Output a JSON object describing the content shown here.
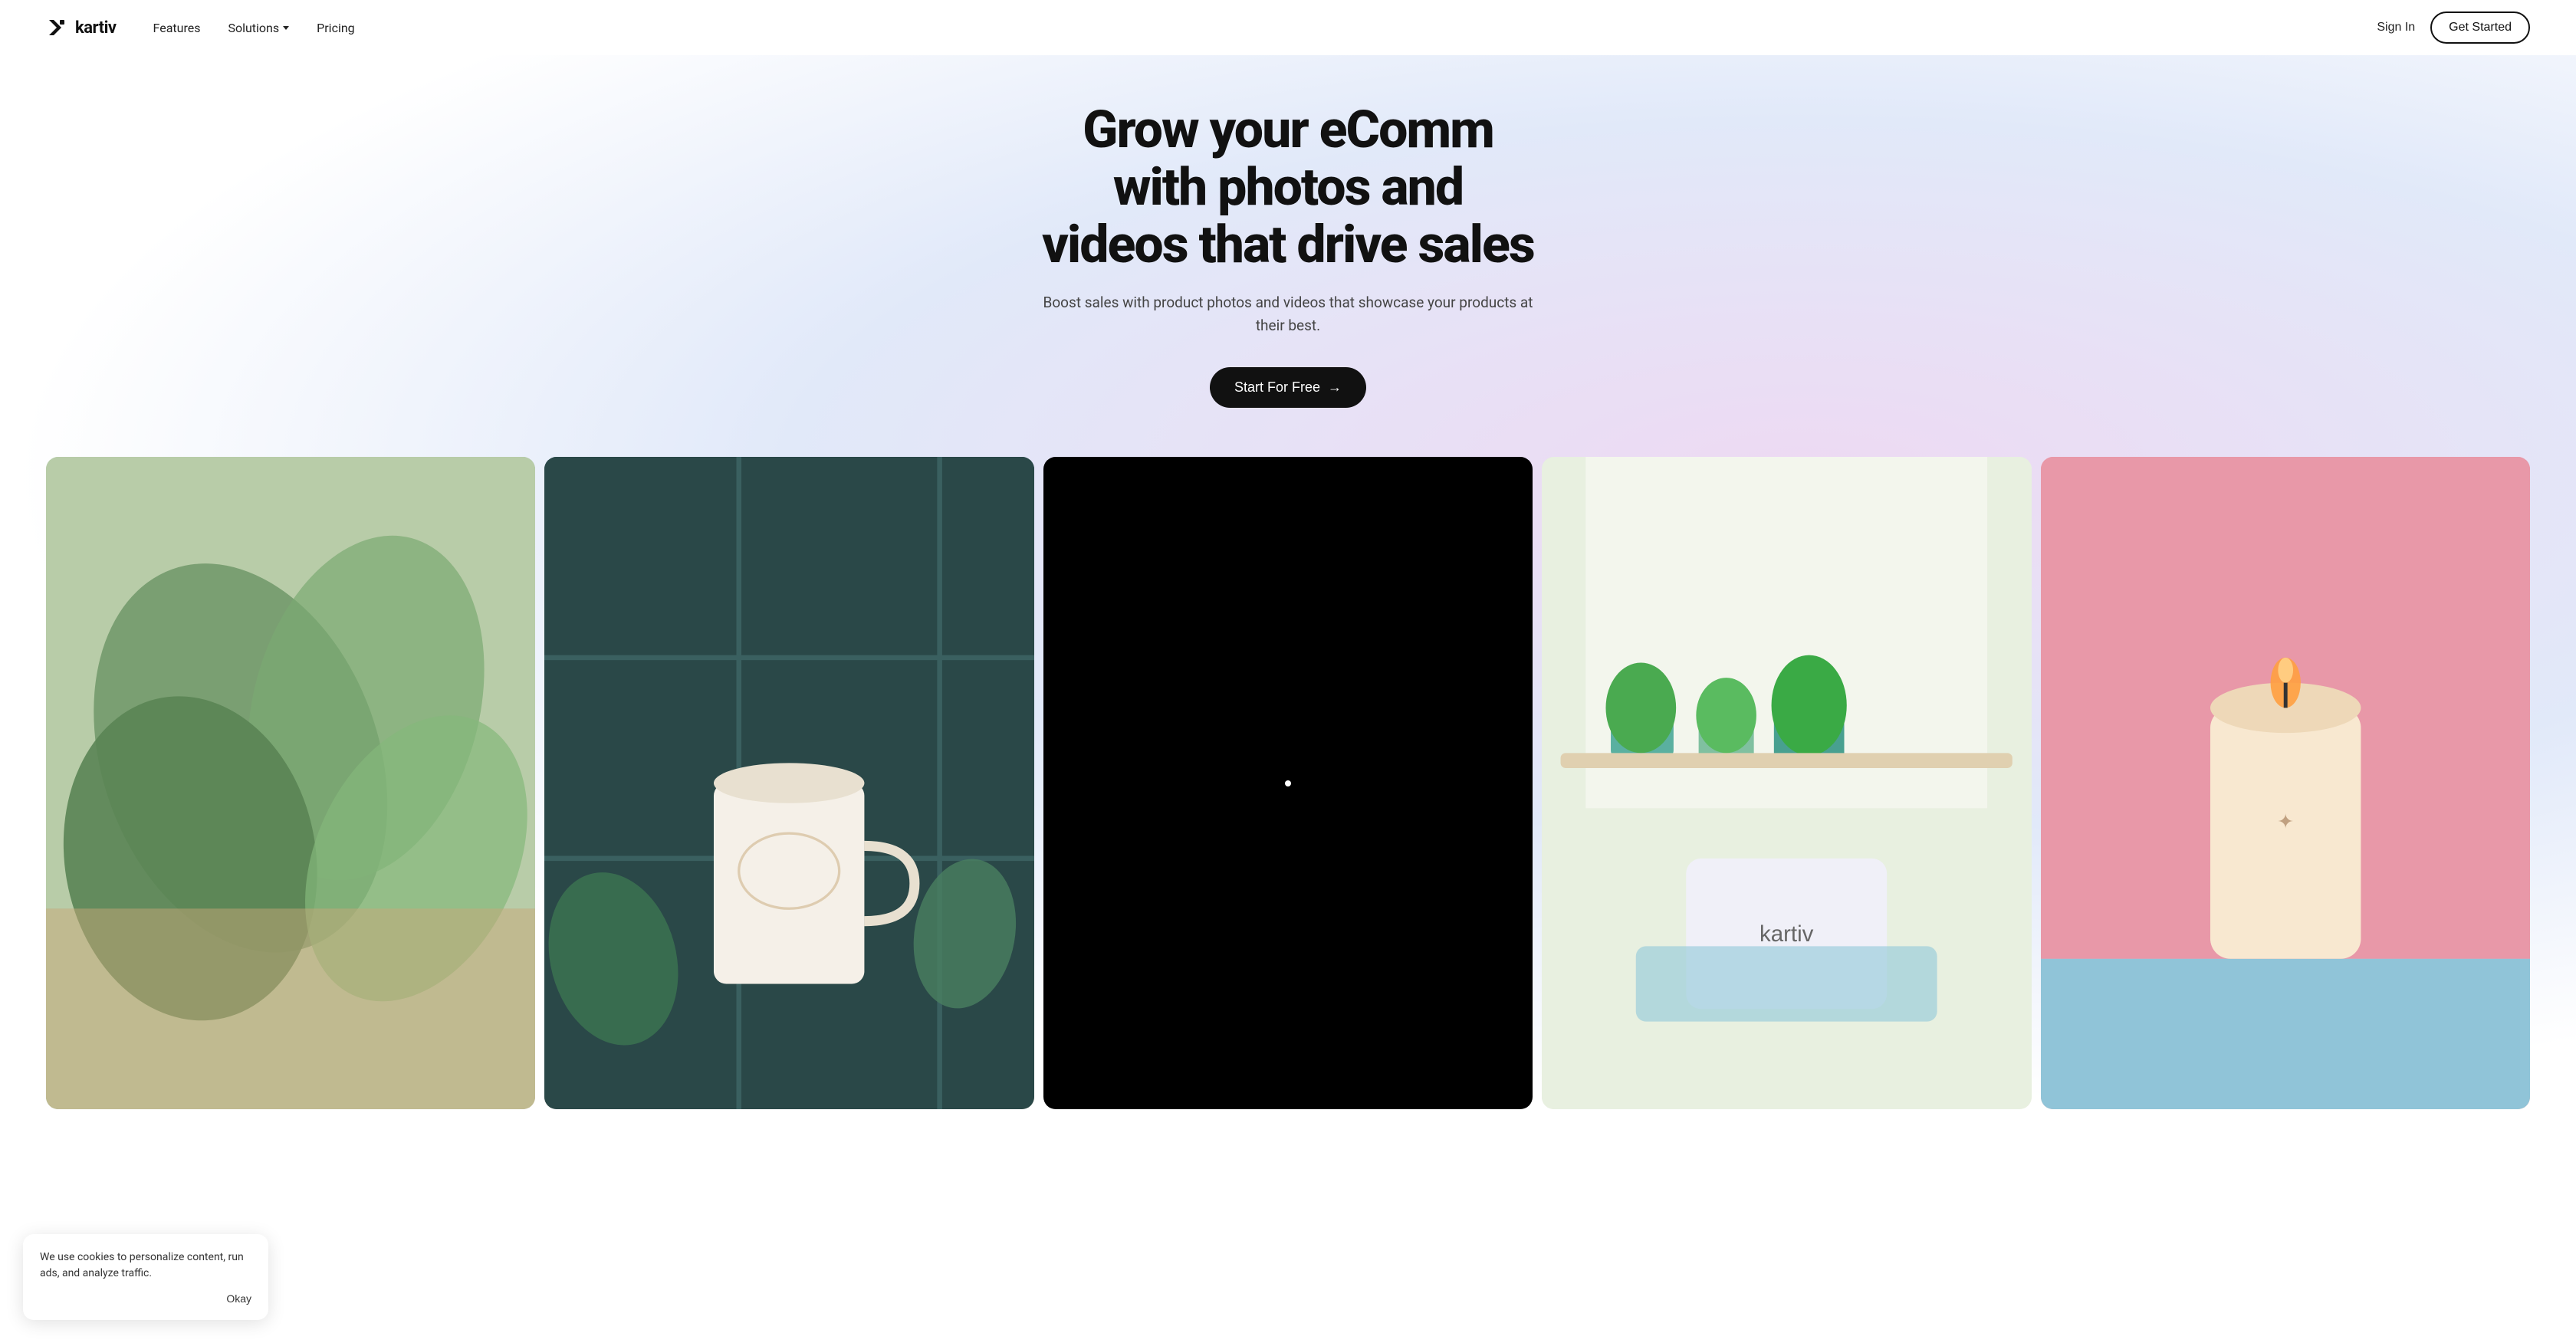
{
  "brand": {
    "logo_text": "kartiv",
    "logo_icon_label": "kartiv-logo-icon"
  },
  "navbar": {
    "features_label": "Features",
    "solutions_label": "Solutions",
    "pricing_label": "Pricing",
    "sign_in_label": "Sign In",
    "get_started_label": "Get Started"
  },
  "hero": {
    "headline": "Grow your eComm with photos and videos that drive sales",
    "subtext": "Boost sales with product photos and videos that showcase your products at their best.",
    "cta_label": "Start For Free",
    "cta_arrow": "→"
  },
  "images": [
    {
      "id": "img1",
      "alt": "plant photo"
    },
    {
      "id": "img2",
      "alt": "coffee cup photo"
    },
    {
      "id": "img3",
      "alt": "video dark"
    },
    {
      "id": "img4",
      "alt": "skincare product photo"
    },
    {
      "id": "img5",
      "alt": "candle pink photo"
    }
  ],
  "cookie": {
    "text": "We use cookies to personalize content, run ads, and analyze traffic.",
    "okay_label": "Okay"
  },
  "colors": {
    "bg_gradient_pink": "#e8c8e8",
    "bg_gradient_blue": "#c8d0f0",
    "cta_bg": "#111111",
    "cta_text": "#ffffff",
    "navbar_border": "#111111"
  }
}
